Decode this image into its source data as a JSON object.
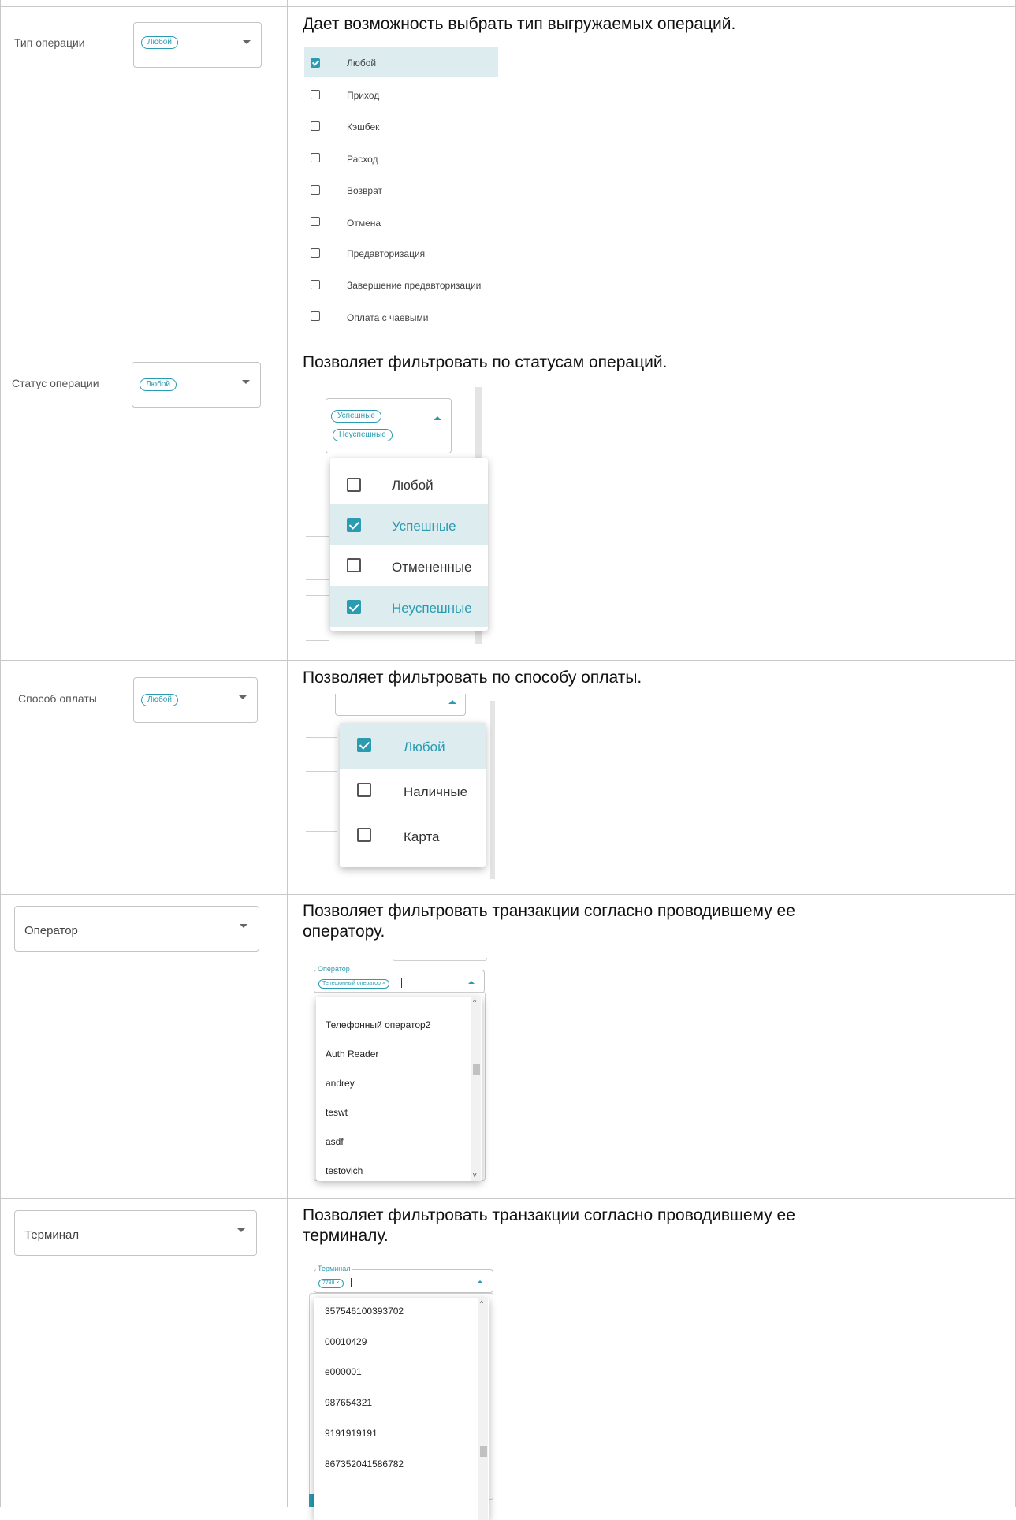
{
  "colors": {
    "accent": "#2a9bb1",
    "highlight": "#dcecef",
    "border": "#c8c8c8"
  },
  "rows": [
    {
      "label": "Тип операции",
      "chip": "Любой",
      "description": "Дает возможность выбрать тип выгружаемых операций.",
      "options": [
        {
          "label": "Любой",
          "checked": true
        },
        {
          "label": "Приход",
          "checked": false
        },
        {
          "label": "Кэшбек",
          "checked": false
        },
        {
          "label": "Расход",
          "checked": false
        },
        {
          "label": "Возврат",
          "checked": false
        },
        {
          "label": "Отмена",
          "checked": false
        },
        {
          "label": "Предавторизация",
          "checked": false
        },
        {
          "label": "Завершение предавторизации",
          "checked": false
        },
        {
          "label": "Оплата с чаевыми",
          "checked": false
        }
      ]
    },
    {
      "label": "Статус операции",
      "chip": "Любой",
      "description": "Позволяет фильтровать по статусам операций.",
      "selected_chips": [
        "Успешные",
        "Неуспешные"
      ],
      "options": [
        {
          "label": "Любой",
          "checked": false
        },
        {
          "label": "Успешные",
          "checked": true
        },
        {
          "label": "Отмененные",
          "checked": false
        },
        {
          "label": "Неуспешные",
          "checked": true
        }
      ]
    },
    {
      "label": "Способ оплаты",
      "chip": "Любой",
      "description": "Позволяет фильтровать по способу оплаты.",
      "options": [
        {
          "label": "Любой",
          "checked": true
        },
        {
          "label": "Наличные",
          "checked": false
        },
        {
          "label": "Карта",
          "checked": false
        }
      ]
    },
    {
      "label": "Оператор",
      "description_lines": [
        "Позволяет фильтровать транзакции согласно проводившему ее",
        "оператору."
      ],
      "field_label": "Оператор",
      "field_chip": "Телефонный оператор ×",
      "list": [
        "Телефонный оператор2",
        "Auth Reader",
        "andrey",
        "teswt",
        "asdf",
        "testovich"
      ]
    },
    {
      "label": "Терминал",
      "description_lines": [
        "Позволяет фильтровать транзакции согласно проводившему ее",
        "терминалу."
      ],
      "field_label": "Терминал",
      "field_chip": "7788 ×",
      "list": [
        "357546100393702",
        "00010429",
        "e000001",
        "987654321",
        "9191919191",
        "867352041586782"
      ]
    }
  ]
}
